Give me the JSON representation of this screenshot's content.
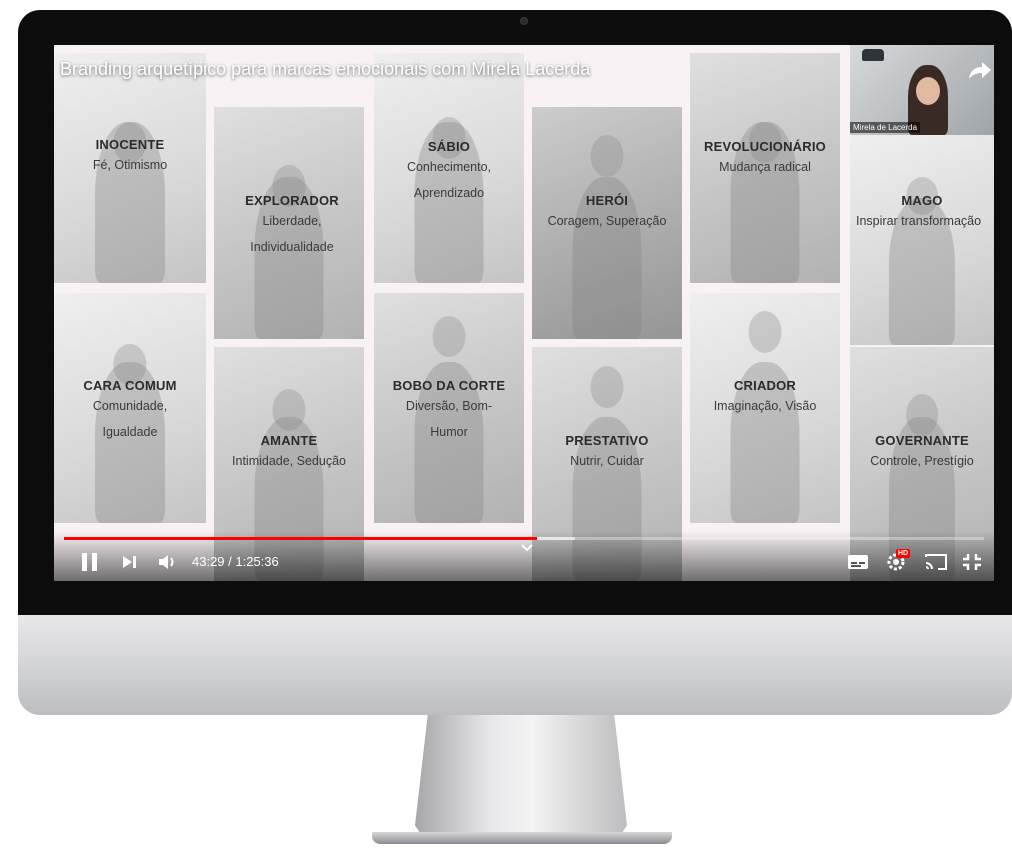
{
  "player": {
    "title": "Branding arquetípico para marcas emocionais com Mirela Lacerda",
    "time_display": "43:29 / 1:25:36",
    "progress_fraction": 0.514,
    "buffer_fraction": 0.555,
    "accent": "#ff0000",
    "controls": [
      "pause-icon",
      "next-icon",
      "volume-icon",
      "subtitles-icon",
      "settings-icon",
      "cast-icon",
      "exit-fullscreen-icon"
    ],
    "hd_badge": "HD"
  },
  "webcam": {
    "name": "Mirela de Lacerda"
  },
  "archetypes": [
    {
      "title": "INOCENTE",
      "subtitle": "Fé, Otimismo"
    },
    {
      "title": "EXPLORADOR",
      "subtitle": "Liberdade, Individualidade"
    },
    {
      "title": "SÁBIO",
      "subtitle": "Conhecimento, Aprendizado"
    },
    {
      "title": "HERÓI",
      "subtitle": "Coragem, Superação"
    },
    {
      "title": "REVOLUCIONÁRIO",
      "subtitle": "Mudança radical"
    },
    {
      "title": "MAGO",
      "subtitle": "Inspirar transformação"
    },
    {
      "title": "CARA COMUM",
      "subtitle": "Comunidade, Igualdade"
    },
    {
      "title": "AMANTE",
      "subtitle": "Intimidade, Sedução"
    },
    {
      "title": "BOBO DA CORTE",
      "subtitle": "Diversão, Bom-Humor"
    },
    {
      "title": "PRESTATIVO",
      "subtitle": "Nutrir, Cuidar"
    },
    {
      "title": "CRIADOR",
      "subtitle": "Imaginação, Visão"
    },
    {
      "title": "GOVERNANTE",
      "subtitle": "Controle, Prestígio"
    }
  ]
}
